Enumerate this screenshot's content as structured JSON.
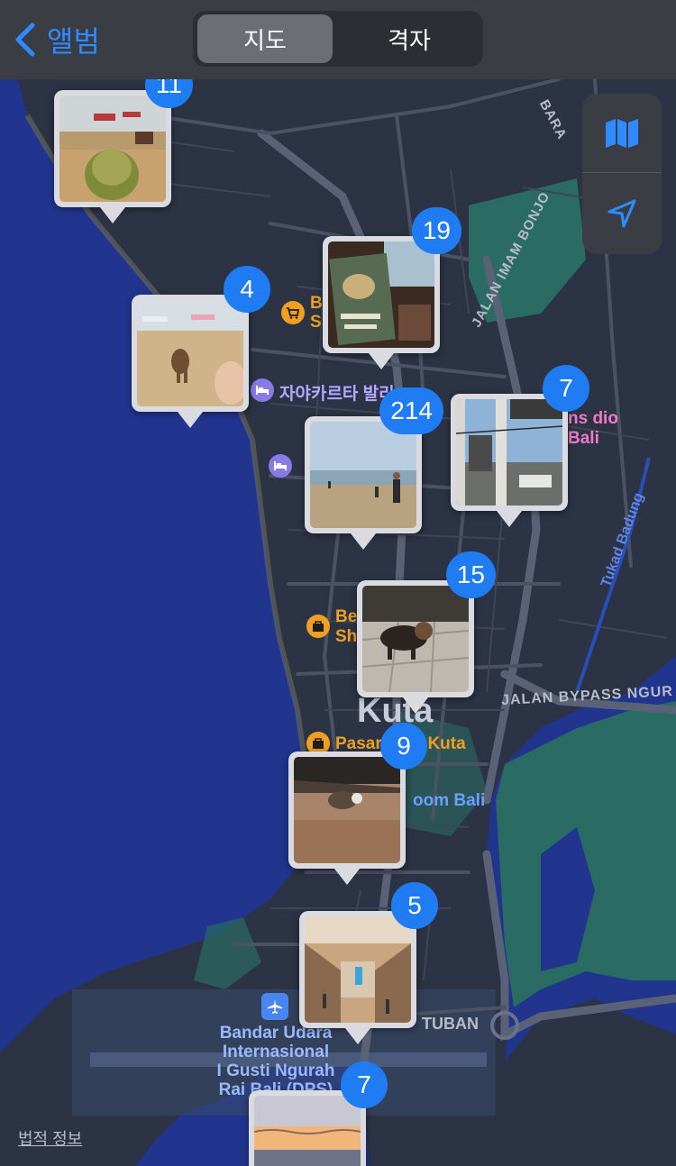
{
  "header": {
    "back_label": "앨범",
    "segments": [
      "지도",
      "격자"
    ],
    "selected_segment": "지도"
  },
  "map": {
    "city_label": "Kuta",
    "road_labels": [
      "JALAN BYPASS NGUR",
      "JALAN IMAM BONJO",
      "BARA",
      "TUBAN"
    ],
    "water_label": "Tukad Badung",
    "poi_labels": [
      {
        "text": "Pasar Seni Kuta",
        "kind": "shopping"
      },
      {
        "text": "자야카르타 발리",
        "kind": "hotel"
      },
      {
        "text": "B S",
        "kind": "shopping"
      },
      {
        "text": "Be Sh",
        "kind": "shopping"
      },
      {
        "text": "ns dio Bali",
        "kind": "attraction"
      },
      {
        "text": "oom Bali",
        "kind": "attraction"
      }
    ],
    "airport_label": [
      "Bandar Udara",
      "Internasional",
      "I Gusti Ngurah",
      "Rai Bali (DPS)"
    ],
    "colors": {
      "sea": "#21358f",
      "land": "#2c3344",
      "road": "#4b5263",
      "park": "#2a6b63",
      "accent": "#1f7cf2"
    }
  },
  "controls": {
    "map_mode_icon": "map-icon",
    "location_icon": "location-arrow-icon"
  },
  "photo_pins": [
    {
      "count": "11",
      "subject": "coconut-on-beach"
    },
    {
      "count": "19",
      "subject": "restaurant-menu"
    },
    {
      "count": "4",
      "subject": "dog-on-beach"
    },
    {
      "count": "7",
      "subject": "street-view"
    },
    {
      "count": "214",
      "subject": "beach-people"
    },
    {
      "count": "15",
      "subject": "dog-on-tiles"
    },
    {
      "count": "9",
      "subject": "dog-night"
    },
    {
      "count": "5",
      "subject": "airport-hall"
    },
    {
      "count": "7",
      "subject": "sunset"
    }
  ],
  "legal_label": "법적 정보"
}
